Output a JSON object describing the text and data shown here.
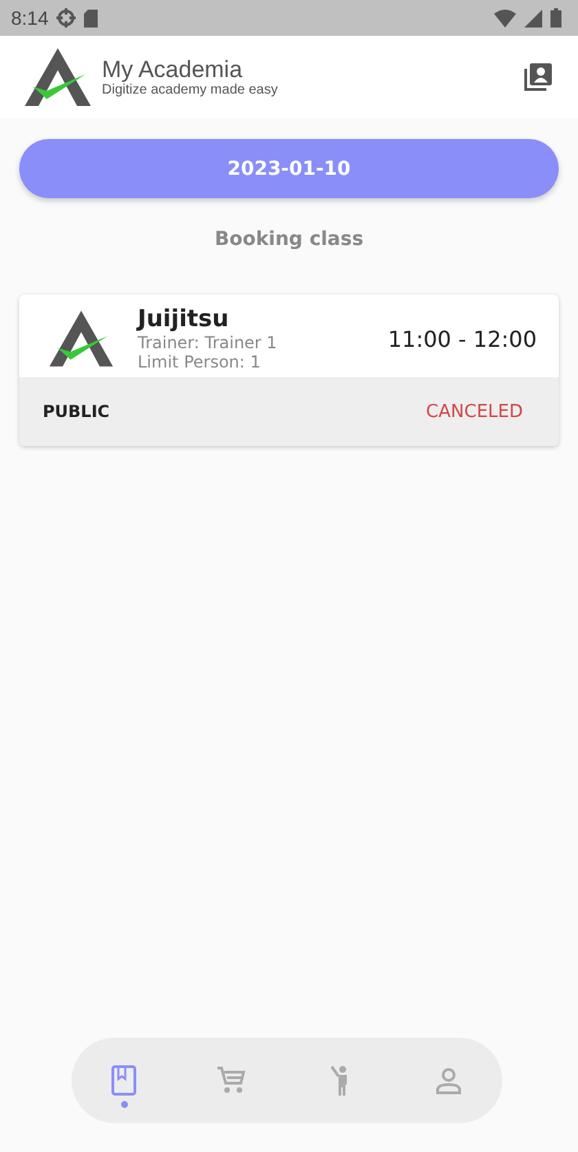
{
  "status_bar": {
    "time": "8:14"
  },
  "header": {
    "app_name": "My Academia",
    "tagline": "Digitize academy made easy"
  },
  "date_button": {
    "label": "2023-01-10"
  },
  "section_title": "Booking class",
  "bookings": [
    {
      "title": "Juijitsu",
      "trainer": "Trainer: Trainer 1",
      "limit": "Limit Person: 1",
      "time": "11:00 -  12:00",
      "visibility": "PUBLIC",
      "status": "CANCELED"
    }
  ],
  "bottom_nav": [
    {
      "kind": "book",
      "selected": true
    },
    {
      "kind": "cart",
      "selected": false
    },
    {
      "kind": "activity",
      "selected": false
    },
    {
      "kind": "profile",
      "selected": false
    }
  ]
}
